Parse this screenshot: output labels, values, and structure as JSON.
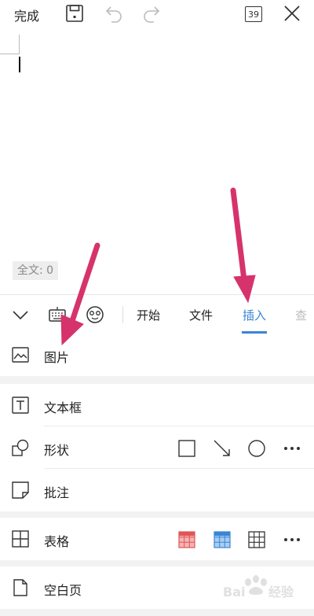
{
  "top_bar": {
    "done_label": "完成",
    "page_count": "39",
    "icons": [
      "save-icon",
      "undo-icon",
      "redo-icon",
      "close-icon"
    ]
  },
  "editor": {
    "word_count": "全文: 0"
  },
  "toolbar": {
    "icons": [
      "collapse-chevron-icon",
      "keyboard-icon",
      "emoji-icon"
    ],
    "tabs": [
      {
        "label": "开始",
        "active": false
      },
      {
        "label": "文件",
        "active": false
      },
      {
        "label": "插入",
        "active": true
      },
      {
        "label": "查",
        "active": false
      }
    ],
    "accent_color": "#3a86d4"
  },
  "insert_menu": {
    "picture": {
      "label": "图片",
      "icon": "picture-icon"
    },
    "textbox": {
      "label": "文本框",
      "icon": "textbox-icon"
    },
    "shape": {
      "label": "形状",
      "icon": "shape-icon",
      "options": [
        "square-shape-icon",
        "arrow-line-icon",
        "circle-shape-icon",
        "more-icon"
      ]
    },
    "comment": {
      "label": "批注",
      "icon": "comment-icon"
    },
    "table": {
      "label": "表格",
      "icon": "table-icon",
      "options": [
        "red-table-style-icon",
        "blue-table-style-icon",
        "plain-table-style-icon",
        "more-icon"
      ]
    },
    "blank_page": {
      "label": "空白页",
      "icon": "blank-page-icon"
    }
  },
  "annotation_arrows": {
    "color": "#d6336c",
    "count": 2
  },
  "watermark": {
    "text": "Baidu 经验"
  }
}
